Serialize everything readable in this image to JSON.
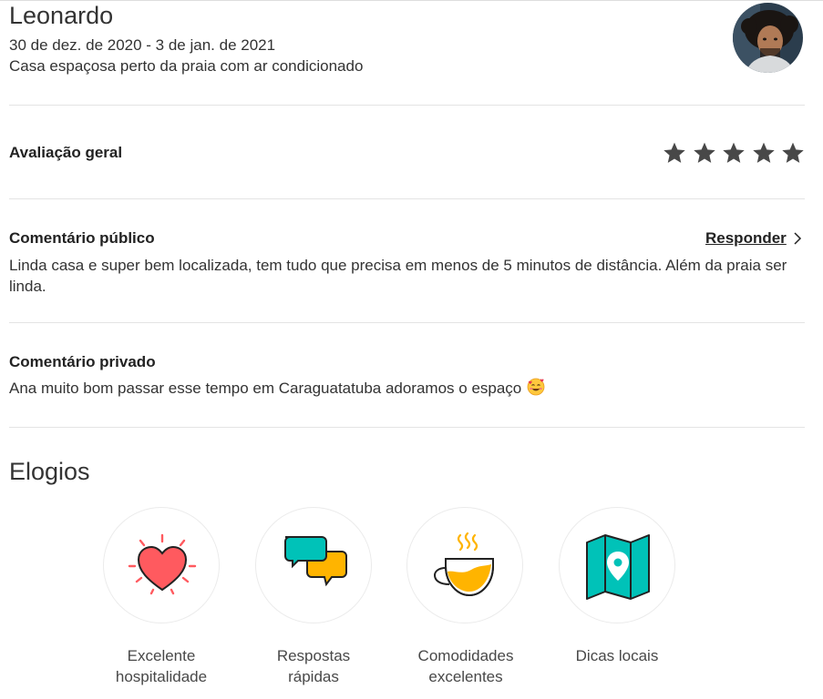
{
  "header": {
    "guest_name": "Leonardo",
    "dates": "30 de dez. de 2020 - 3 de jan. de 2021",
    "listing_title": "Casa espaçosa perto da praia com ar condicionado"
  },
  "overall_rating": {
    "label": "Avaliação geral",
    "stars": 5,
    "max_stars": 5
  },
  "public_comment": {
    "title": "Comentário público",
    "reply_label": "Responder",
    "text": "Linda casa e super bem localizada, tem tudo que precisa em menos de 5 minutos de distância. Além da praia ser linda."
  },
  "private_comment": {
    "title": "Comentário privado",
    "text": "Ana muito bom passar esse tempo em Caraguatatuba adoramos o espaço",
    "emoji": "smiling-face-with-hearts-emoji"
  },
  "compliments": {
    "title": "Elogios",
    "items": [
      {
        "icon": "heart-icon",
        "label_line1": "Excelente",
        "label_line2": "hospitalidade"
      },
      {
        "icon": "chat-bubbles-icon",
        "label_line1": "Respostas",
        "label_line2": "rápidas"
      },
      {
        "icon": "coffee-cup-icon",
        "label_line1": "Comodidades",
        "label_line2": "excelentes"
      },
      {
        "icon": "map-pin-icon",
        "label_line1": "Dicas locais",
        "label_line2": ""
      }
    ]
  },
  "colors": {
    "text": "#222222",
    "star": "#484848",
    "heart": "#FF5A5F",
    "teal": "#00C2B8",
    "yellow": "#FFB400",
    "divider": "#e4e4e4"
  }
}
